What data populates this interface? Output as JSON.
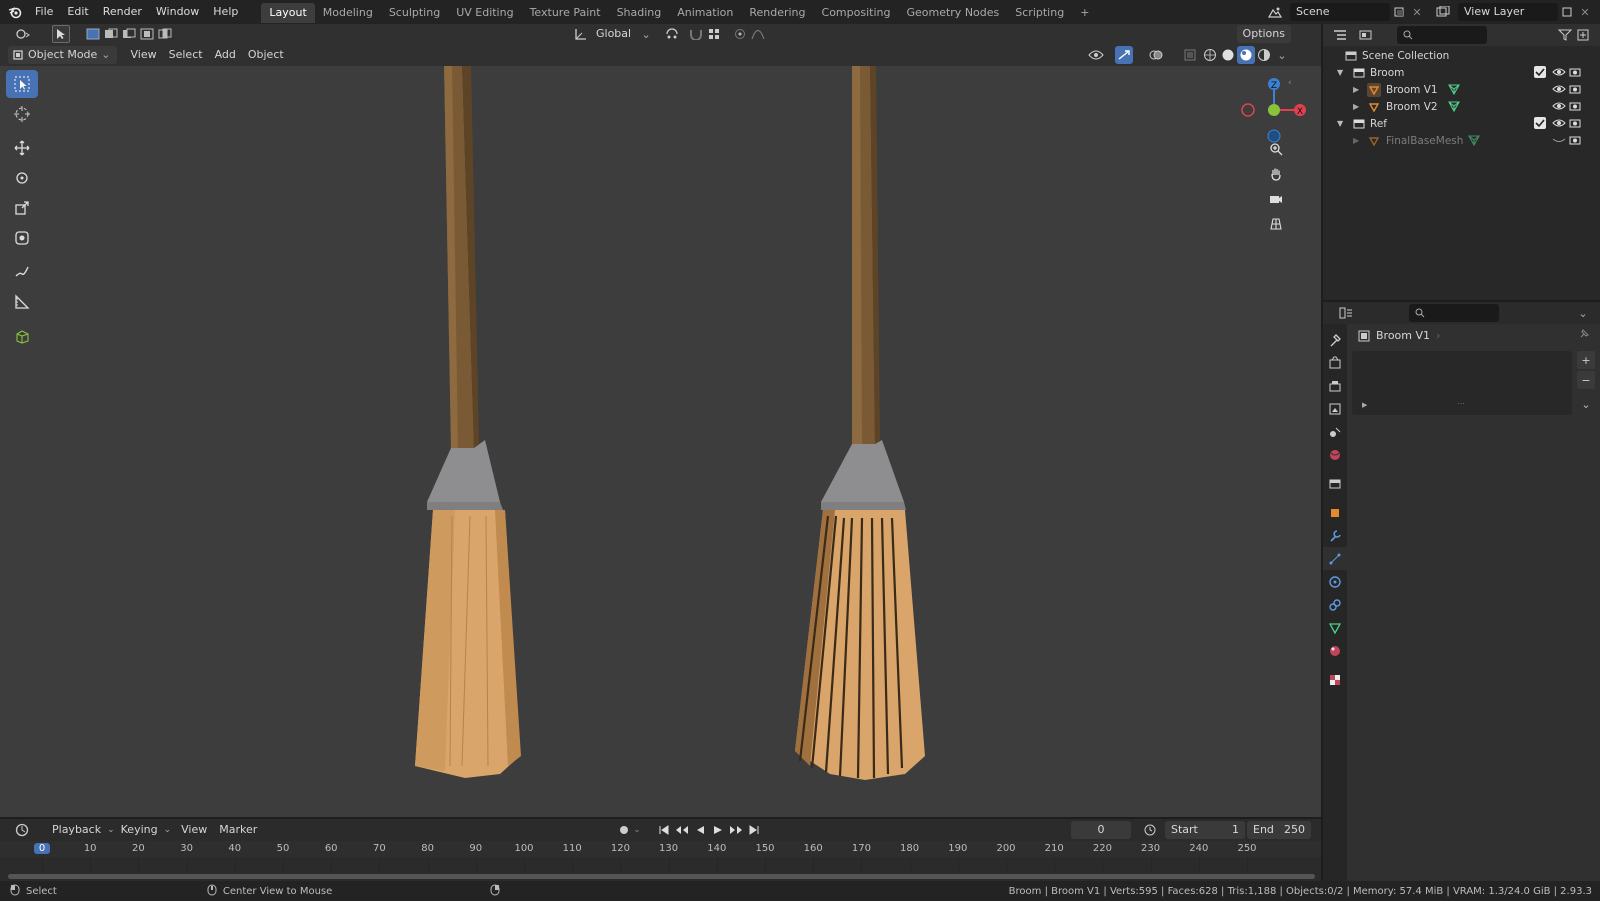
{
  "topbar": {
    "menus": [
      "File",
      "Edit",
      "Render",
      "Window",
      "Help"
    ],
    "workspaces": [
      "Layout",
      "Modeling",
      "Sculpting",
      "UV Editing",
      "Texture Paint",
      "Shading",
      "Animation",
      "Rendering",
      "Compositing",
      "Geometry Nodes",
      "Scripting"
    ],
    "active_workspace": "Layout",
    "add_label": "+",
    "scene": "Scene",
    "view_layer": "View Layer"
  },
  "viewport": {
    "mode": "Object Mode",
    "menus": [
      "View",
      "Select",
      "Add",
      "Object"
    ],
    "orientation": "Global",
    "options": "Options"
  },
  "gizmo": {
    "x": "X",
    "y": "Y",
    "z": "Z"
  },
  "outliner": {
    "root": "Scene Collection",
    "items": [
      {
        "name": "Broom",
        "level": 0,
        "type": "collection"
      },
      {
        "name": "Broom V1",
        "level": 1,
        "type": "object"
      },
      {
        "name": "Broom V2",
        "level": 1,
        "type": "object"
      },
      {
        "name": "Ref",
        "level": 0,
        "type": "collection"
      },
      {
        "name": "FinalBaseMesh",
        "level": 1,
        "type": "object",
        "dim": true
      }
    ]
  },
  "properties": {
    "object_name": "Broom V1"
  },
  "timeline": {
    "menus": [
      "Playback",
      "Keying",
      "View",
      "Marker"
    ],
    "current_frame": "0",
    "start_label": "Start",
    "start": "1",
    "end_label": "End",
    "end": "250",
    "ticks": [
      "0",
      "10",
      "20",
      "30",
      "40",
      "50",
      "60",
      "70",
      "80",
      "90",
      "100",
      "110",
      "120",
      "130",
      "140",
      "150",
      "160",
      "170",
      "180",
      "190",
      "200",
      "210",
      "220",
      "230",
      "240",
      "250"
    ]
  },
  "status": {
    "left_action": "Select",
    "mid_action": "Center View to Mouse",
    "stats": "Broom | Broom V1 | Verts:595 | Faces:628 | Tris:1,188 | Objects:0/2 | Memory: 57.4 MiB | VRAM: 1.3/24.0 GiB | 2.93.3"
  },
  "colors": {
    "accent": "#4772b3",
    "handle": "#7a5a34",
    "bristle": "#d9a56a",
    "ferrule": "#8e8e90",
    "x_axis": "#e2404f",
    "y_axis": "#8ac33b",
    "z_axis": "#3b82d6"
  }
}
